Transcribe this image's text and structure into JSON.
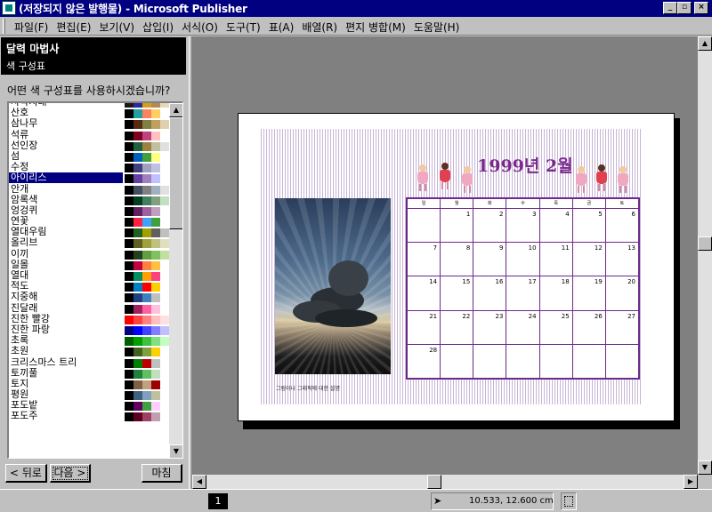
{
  "window": {
    "title": "(저장되지 않은 발행물) - Microsoft Publisher",
    "controls": {
      "minimize": "_",
      "maximize": "▫",
      "close": "×"
    }
  },
  "menu": [
    "파일(F)",
    "편집(E)",
    "보기(V)",
    "삽입(I)",
    "서식(O)",
    "도구(T)",
    "표(A)",
    "배열(R)",
    "편지 병합(M)",
    "도움말(H)"
  ],
  "wizard": {
    "title": "달력 마법사",
    "step": "색 구성표",
    "question": "어떤 색 구성표를 사용하시겠습니까?",
    "selected_index": 7,
    "schemes": [
      {
        "name": "사막지대",
        "colors": [
          "#1a1a1a",
          "#2a2a9a",
          "#d4a017",
          "#b08a5a",
          "#e8d8b8"
        ]
      },
      {
        "name": "산호",
        "colors": [
          "#000000",
          "#20a0a0",
          "#ff8060",
          "#ffd060",
          "#ffffff"
        ]
      },
      {
        "name": "삼나무",
        "colors": [
          "#000000",
          "#5a2a10",
          "#808040",
          "#c0a060",
          "#e0d0b0"
        ]
      },
      {
        "name": "석류",
        "colors": [
          "#000000",
          "#800020",
          "#c04080",
          "#ffc0c0",
          "#ffffff"
        ]
      },
      {
        "name": "선인장",
        "colors": [
          "#000000",
          "#206040",
          "#a08040",
          "#c0c0a0",
          "#e0e0e0"
        ]
      },
      {
        "name": "섬",
        "colors": [
          "#000000",
          "#0060c0",
          "#40a040",
          "#ffff80",
          "#ffffff"
        ]
      },
      {
        "name": "수정",
        "colors": [
          "#000000",
          "#404080",
          "#a0a0c0",
          "#c0c0e0",
          "#ffffff"
        ]
      },
      {
        "name": "아이리스",
        "colors": [
          "#000000",
          "#6040a0",
          "#a080c0",
          "#c0c0ff",
          "#ffffff"
        ]
      },
      {
        "name": "안개",
        "colors": [
          "#000000",
          "#405060",
          "#808080",
          "#a0b0c0",
          "#e0e0e0"
        ]
      },
      {
        "name": "암록색",
        "colors": [
          "#000000",
          "#004020",
          "#408060",
          "#80a080",
          "#c0e0c0"
        ]
      },
      {
        "name": "엉겅퀴",
        "colors": [
          "#000000",
          "#602060",
          "#a060a0",
          "#c0a0c0",
          "#ffffff"
        ]
      },
      {
        "name": "연꽃",
        "colors": [
          "#000000",
          "#ff2040",
          "#40a0ff",
          "#40a040",
          "#ffffff"
        ]
      },
      {
        "name": "열대우림",
        "colors": [
          "#000000",
          "#206020",
          "#a0a000",
          "#606060",
          "#c0c0c0"
        ]
      },
      {
        "name": "올리브",
        "colors": [
          "#000000",
          "#606020",
          "#a0a040",
          "#c0c080",
          "#e0e0c0"
        ]
      },
      {
        "name": "이끼",
        "colors": [
          "#000000",
          "#204020",
          "#60a040",
          "#80c060",
          "#c0e0a0"
        ]
      },
      {
        "name": "일몰",
        "colors": [
          "#000000",
          "#c00040",
          "#ff8040",
          "#ffc040",
          "#ffffff"
        ]
      },
      {
        "name": "열대",
        "colors": [
          "#000000",
          "#009060",
          "#ffa000",
          "#ff4080",
          "#ffffff"
        ]
      },
      {
        "name": "적도",
        "colors": [
          "#000000",
          "#0080c0",
          "#ff0000",
          "#ffd000",
          "#ffffff"
        ]
      },
      {
        "name": "지중해",
        "colors": [
          "#000000",
          "#204080",
          "#4080c0",
          "#c0c0c0",
          "#ffffff"
        ]
      },
      {
        "name": "진달래",
        "colors": [
          "#000000",
          "#a02060",
          "#ff60a0",
          "#ffc0e0",
          "#ffffff"
        ]
      },
      {
        "name": "진한 빨강",
        "colors": [
          "#ff0000",
          "#ff4040",
          "#ff8080",
          "#ffc0c0",
          "#ffe0e0"
        ]
      },
      {
        "name": "진한 파랑",
        "colors": [
          "#000080",
          "#0000ff",
          "#4040ff",
          "#8080ff",
          "#c0c0ff"
        ]
      },
      {
        "name": "초록",
        "colors": [
          "#006000",
          "#00a000",
          "#40c040",
          "#80e080",
          "#c0ffc0"
        ]
      },
      {
        "name": "초원",
        "colors": [
          "#000000",
          "#406020",
          "#80a040",
          "#ffd000",
          "#ffffff"
        ]
      },
      {
        "name": "크리스마스 트리",
        "colors": [
          "#000000",
          "#008000",
          "#c00000",
          "#c0c0c0",
          "#ffffff"
        ]
      },
      {
        "name": "토끼풀",
        "colors": [
          "#000000",
          "#208040",
          "#60c060",
          "#c0e0c0",
          "#ffffff"
        ]
      },
      {
        "name": "토지",
        "colors": [
          "#000000",
          "#806040",
          "#c0a080",
          "#a00000",
          "#ffffff"
        ]
      },
      {
        "name": "평원",
        "colors": [
          "#000000",
          "#406080",
          "#80a0c0",
          "#c0c0a0",
          "#ffffff"
        ]
      },
      {
        "name": "포도밭",
        "colors": [
          "#000000",
          "#600060",
          "#40a040",
          "#ffd0ff",
          "#ffffff"
        ]
      },
      {
        "name": "포도주",
        "colors": [
          "#000000",
          "#600020",
          "#a04060",
          "#c0a0b0",
          "#ffffff"
        ]
      }
    ],
    "buttons": {
      "back": "< 뒤로",
      "next": "다음 >",
      "finish": "마침"
    }
  },
  "calendar": {
    "title": "1999년 2월",
    "weekday_labels": [
      "일",
      "월",
      "화",
      "수",
      "목",
      "금",
      "토"
    ],
    "weeks": [
      [
        "",
        "1",
        "2",
        "3",
        "4",
        "5",
        "6"
      ],
      [
        "7",
        "8",
        "9",
        "10",
        "11",
        "12",
        "13"
      ],
      [
        "14",
        "15",
        "16",
        "17",
        "18",
        "19",
        "20"
      ],
      [
        "21",
        "22",
        "23",
        "24",
        "25",
        "26",
        "27"
      ],
      [
        "28",
        "",
        "",
        "",
        "",
        "",
        ""
      ]
    ],
    "photo_caption": "그림이나 그래픽에 대한 설명",
    "accent_color": "#7a2a8c"
  },
  "statusbar": {
    "page_number": "1",
    "coordinates": "10.533, 12.600 cm"
  }
}
